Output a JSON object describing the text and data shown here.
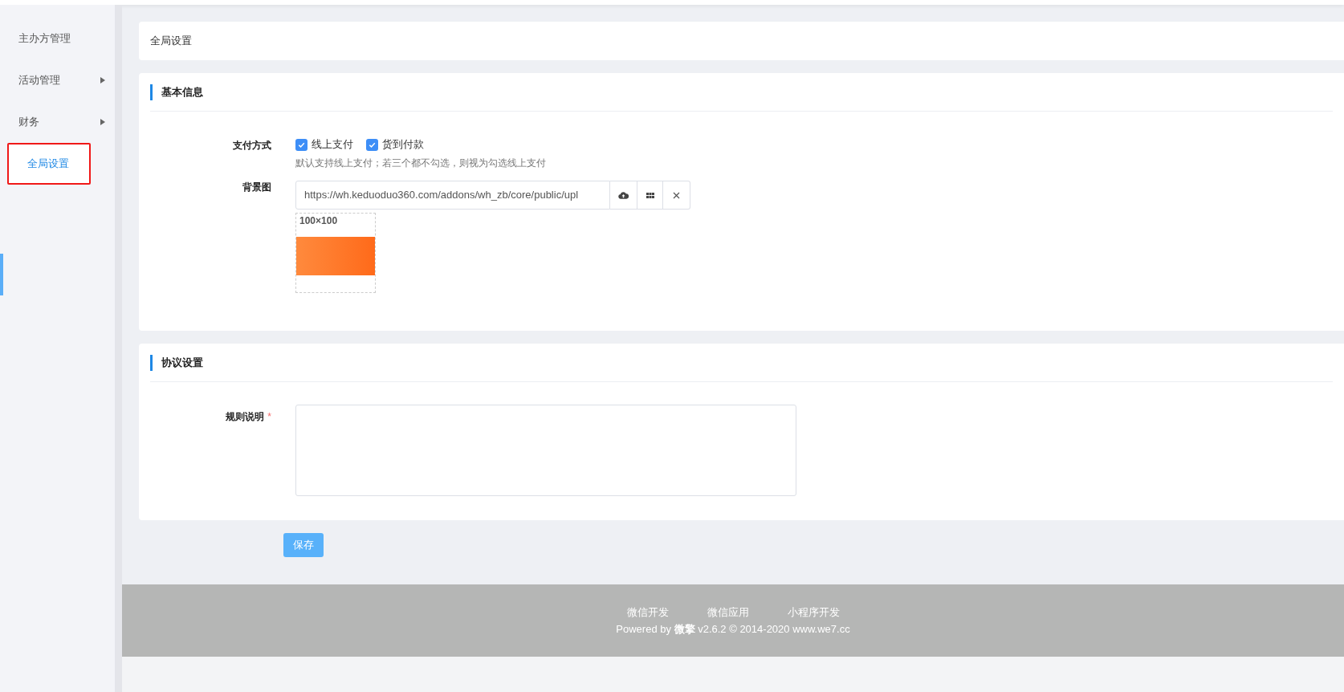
{
  "sidebar": {
    "items": [
      {
        "label": "主办方管理",
        "expandable": false,
        "selected": false,
        "highlighted": false
      },
      {
        "label": "活动管理",
        "expandable": true,
        "selected": false,
        "highlighted": false
      },
      {
        "label": "财务",
        "expandable": true,
        "selected": false,
        "highlighted": false
      },
      {
        "label": "全局设置",
        "expandable": false,
        "selected": true,
        "highlighted": true
      }
    ]
  },
  "page_title": "全局设置",
  "basic_info": {
    "title": "基本信息",
    "payment": {
      "label": "支付方式",
      "options": [
        {
          "label": "线上支付",
          "checked": true
        },
        {
          "label": "货到付款",
          "checked": true
        }
      ],
      "hint": "默认支持线上支付；若三个都不勾选，则视为勾选线上支付"
    },
    "background": {
      "label": "背景图",
      "value": "https://wh.keduoduo360.com/addons/wh_zb/core/public/upl",
      "size_label": "100×100"
    }
  },
  "agreement": {
    "title": "协议设置",
    "rules": {
      "label": "规则说明",
      "required": true,
      "marker": "*"
    }
  },
  "save_button": "保存",
  "footer": {
    "links": [
      "微信开发",
      "微信应用",
      "小程序开发"
    ],
    "powered": "Powered by **微擎** v2.6.2 © 2014-2020 www.we7.cc"
  }
}
